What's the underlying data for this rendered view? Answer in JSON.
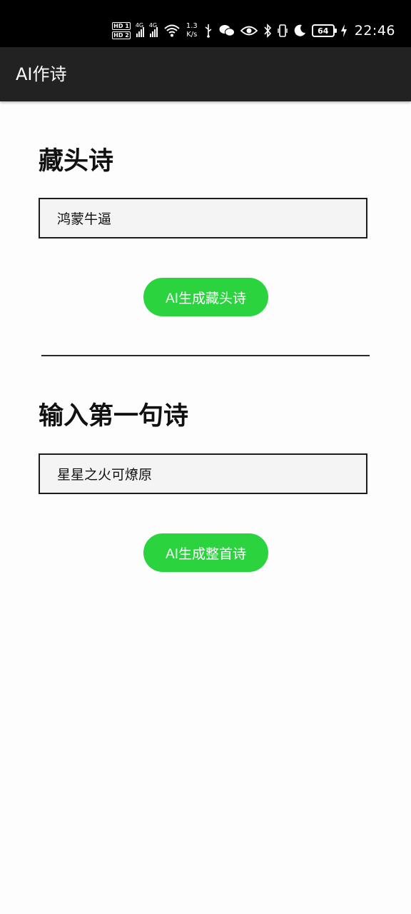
{
  "status_bar": {
    "sim1": "HD 1",
    "sim2": "HD 2",
    "net1": "4G",
    "net2": "4G",
    "speed_value": "1.3",
    "speed_unit": "K/s",
    "battery": "64",
    "time": "22:46",
    "icons": [
      "wifi-icon",
      "usb-icon",
      "wechat-icon",
      "eye-icon",
      "bluetooth-icon",
      "vibrate-icon",
      "moon-icon",
      "charging-icon"
    ]
  },
  "app_bar": {
    "title": "AI作诗"
  },
  "acrostic": {
    "title": "藏头诗",
    "input_value": "鸿蒙牛逼",
    "button_label": "AI生成藏头诗"
  },
  "first_line": {
    "title": "输入第一句诗",
    "input_value": "星星之火可燎原",
    "button_label": "AI生成整首诗"
  },
  "colors": {
    "app_bar_bg": "#222222",
    "button_green": "#2bd33f",
    "status_bar_bg": "#000000"
  }
}
